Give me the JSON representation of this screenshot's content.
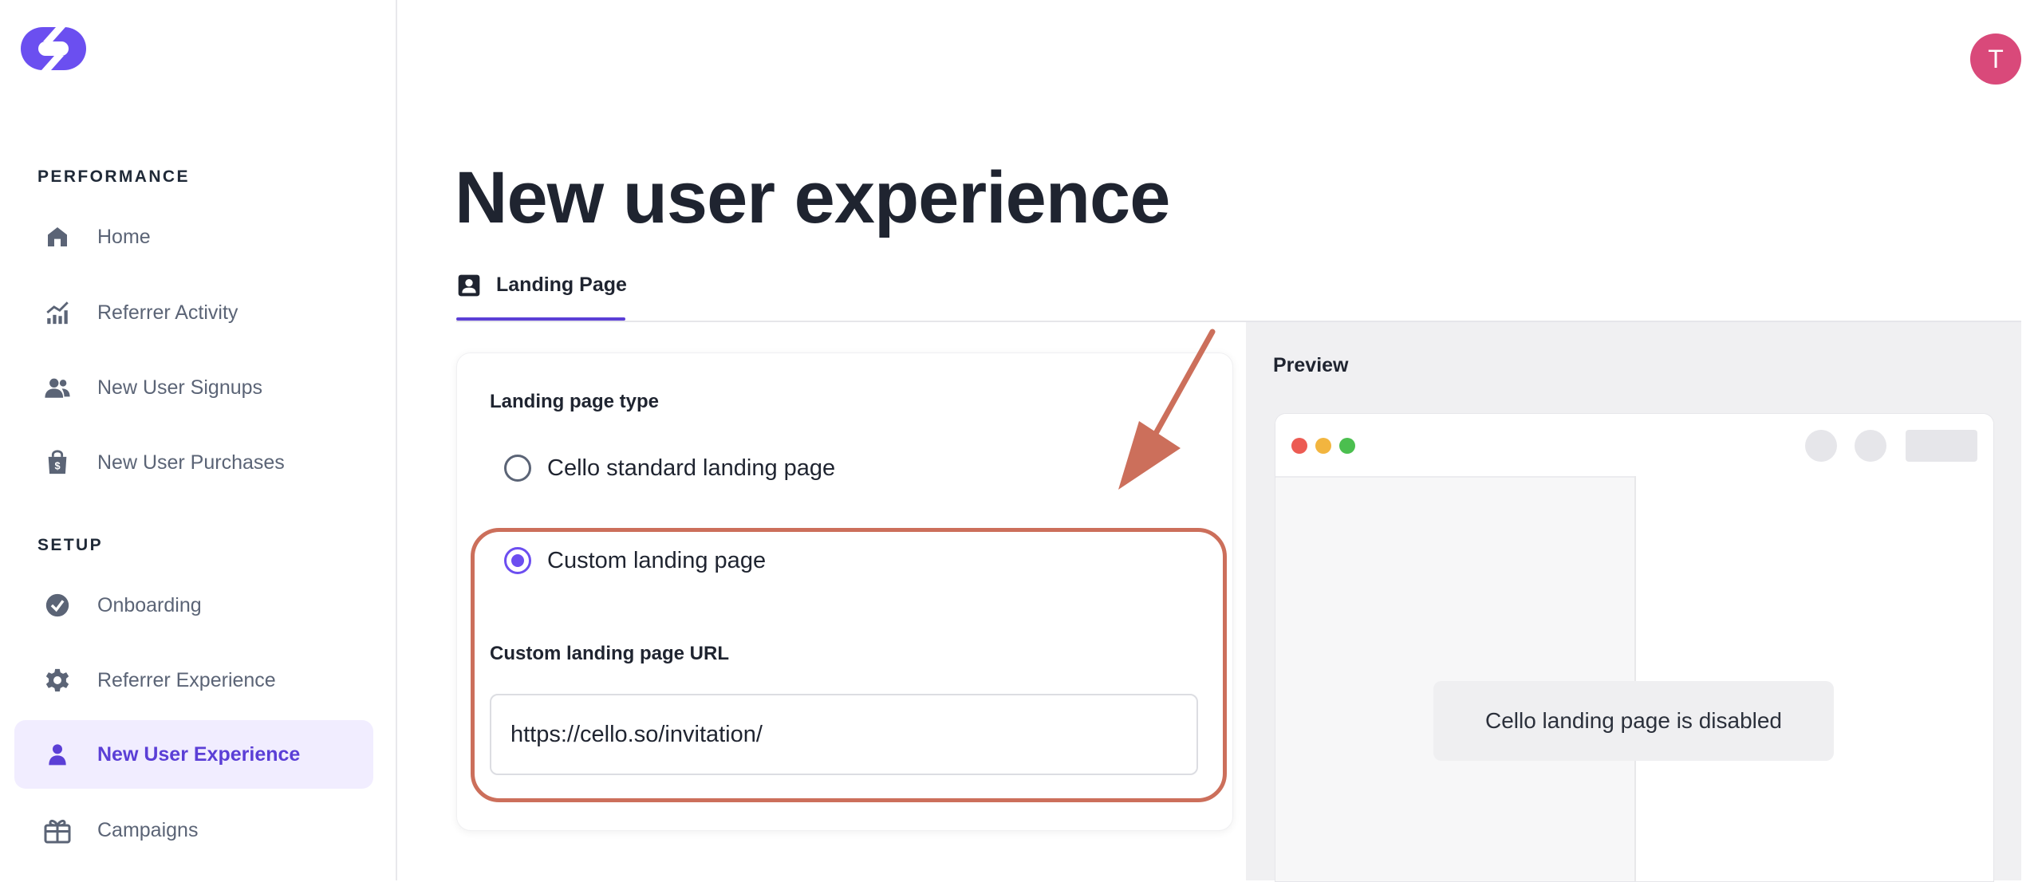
{
  "colors": {
    "accent": "#5b3fd6",
    "radio_accent": "#6c4ef0",
    "highlight": "#cc6f5b",
    "avatar_bg": "#d9497a",
    "dot_red": "#ec5b53",
    "dot_yellow": "#f2b53f",
    "dot_green": "#4bbf4f"
  },
  "logo": {
    "icon": "cello-logo-icon"
  },
  "sidebar": {
    "sections": [
      {
        "label": "PERFORMANCE",
        "items": [
          {
            "label": "Home",
            "icon": "home-icon"
          },
          {
            "label": "Referrer Activity",
            "icon": "chart-icon"
          },
          {
            "label": "New User Signups",
            "icon": "users-icon"
          },
          {
            "label": "New User Purchases",
            "icon": "shopping-bag-icon"
          }
        ]
      },
      {
        "label": "SETUP",
        "items": [
          {
            "label": "Onboarding",
            "icon": "check-circle-icon"
          },
          {
            "label": "Referrer Experience",
            "icon": "gear-icon"
          },
          {
            "label": "New User Experience",
            "icon": "user-icon",
            "active": true
          },
          {
            "label": "Campaigns",
            "icon": "gift-icon"
          }
        ]
      }
    ]
  },
  "user": {
    "avatar_initial": "T"
  },
  "main": {
    "title": "New user experience",
    "tabs": [
      {
        "label": "Landing Page",
        "icon": "contact-card-icon",
        "active": true
      }
    ]
  },
  "settings": {
    "type_label": "Landing page type",
    "options": [
      {
        "label": "Cello standard landing page",
        "checked": false
      },
      {
        "label": "Custom landing page",
        "checked": true
      }
    ],
    "url_label": "Custom landing page URL",
    "url_value": "https://cello.so/invitation/"
  },
  "preview": {
    "label": "Preview",
    "disabled_message": "Cello landing page is disabled"
  }
}
